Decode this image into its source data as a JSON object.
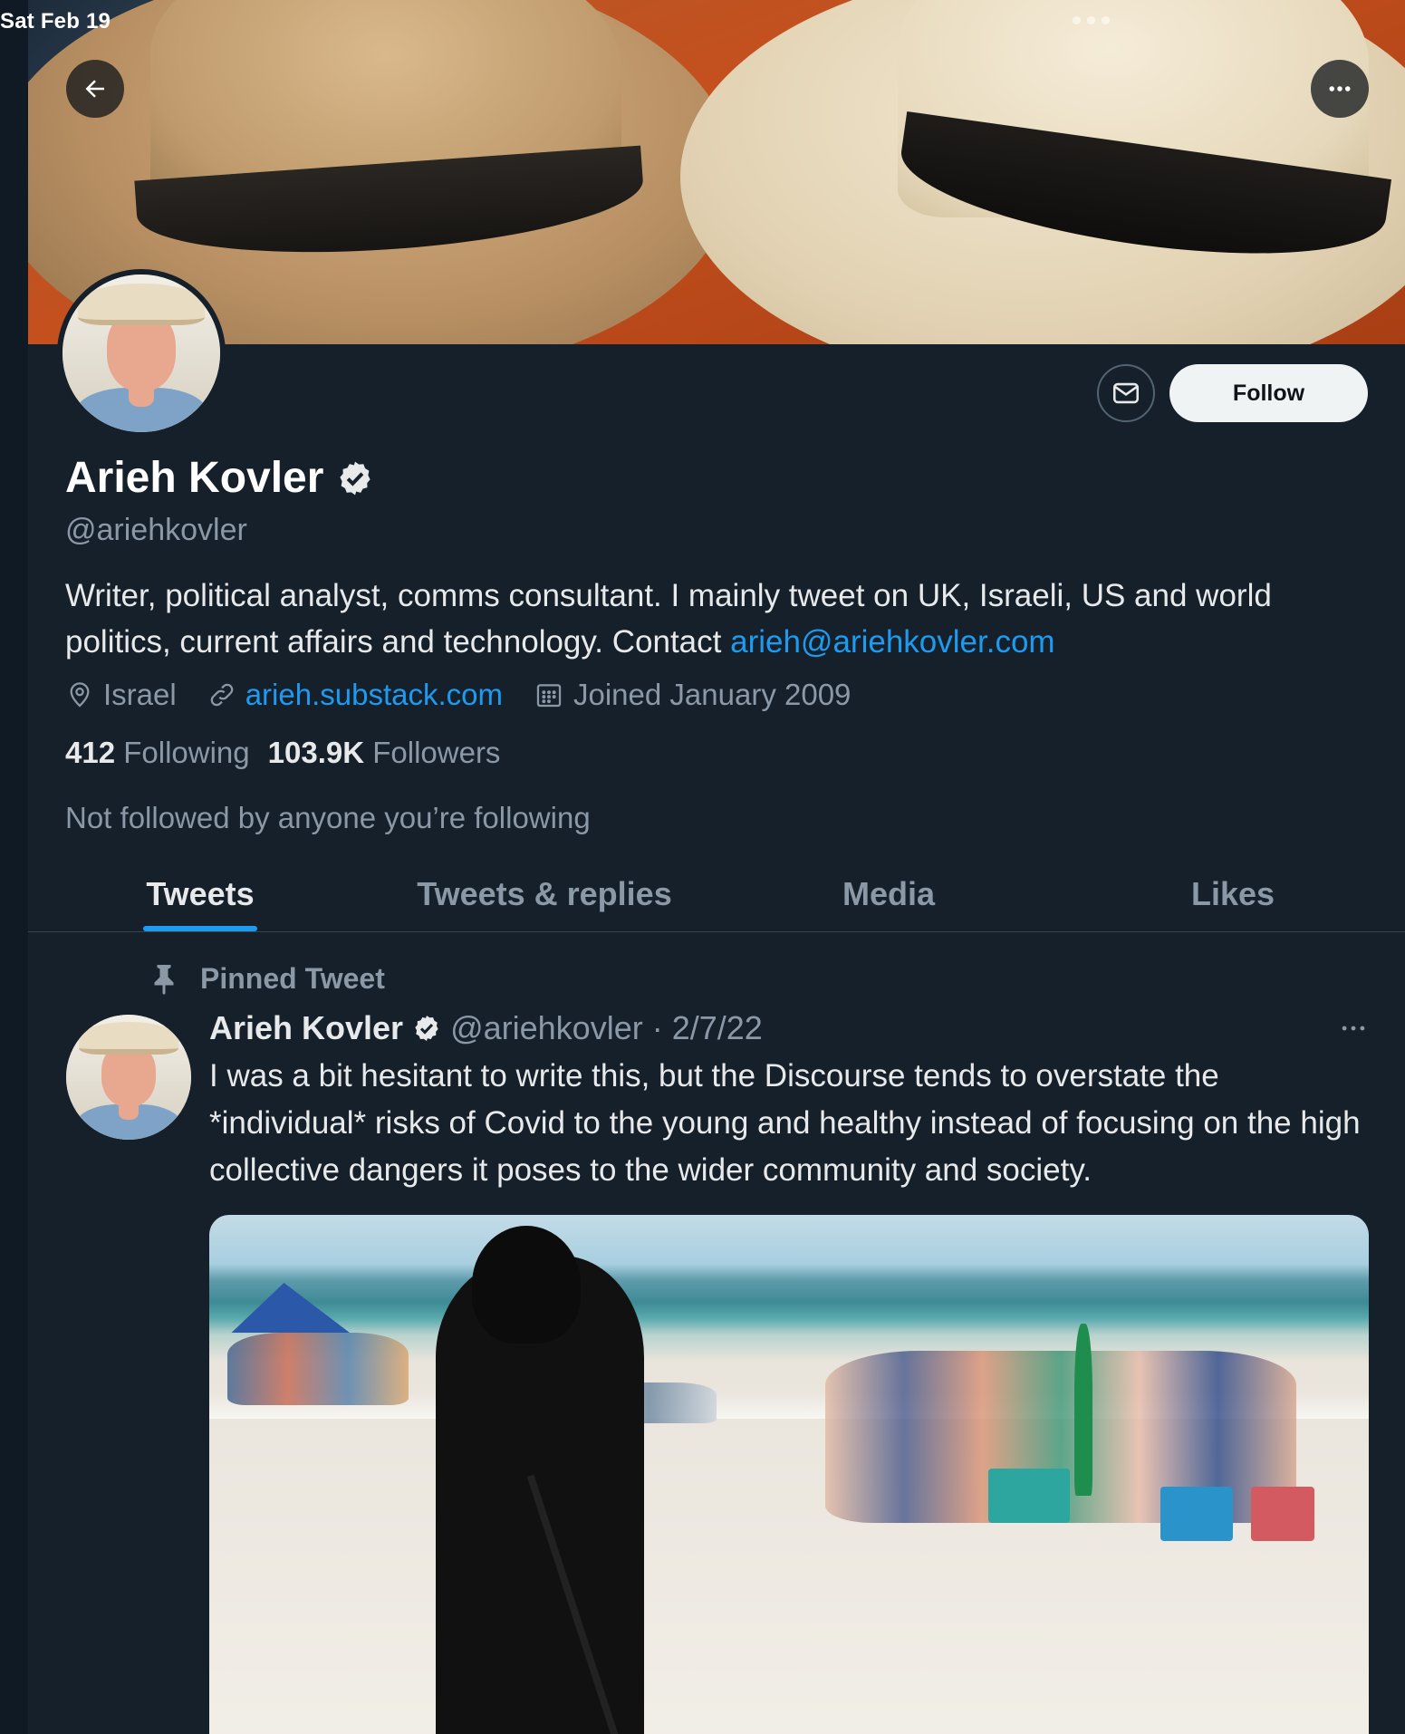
{
  "status_bar": {
    "time": "Sat Feb 19"
  },
  "profile": {
    "name": "Arieh Kovler",
    "handle": "@ariehkovler",
    "bio_text": "Writer, political analyst, comms consultant. I mainly tweet on UK, Israeli, US and world politics, current affairs and technology. Contact ",
    "bio_link": "arieh@ariehkovler.com",
    "location": "Israel",
    "website": "arieh.substack.com",
    "joined": "Joined January 2009",
    "following_count": "412",
    "following_label": "Following",
    "followers_count": "103.9K",
    "followers_label": "Followers",
    "not_followed": "Not followed by anyone you’re following",
    "follow_button": "Follow"
  },
  "tabs": [
    {
      "label": "Tweets",
      "active": true
    },
    {
      "label": "Tweets & replies",
      "active": false
    },
    {
      "label": "Media",
      "active": false
    },
    {
      "label": "Likes",
      "active": false
    }
  ],
  "pinned_tweet": {
    "pinned_label": "Pinned Tweet",
    "author": "Arieh Kovler",
    "handle_date": "@ariehkovler · 2/7/22",
    "text": "I was a bit hesitant to write this, but the Discourse tends to overstate the *individual* risks of Covid to the young and healthy instead of focusing on the high collective dangers it poses to the wider community and society."
  },
  "icons": {
    "back": "arrow-left-icon",
    "more": "more-horizontal-icon",
    "message": "envelope-icon",
    "verified": "verified-badge-icon",
    "location": "location-pin-icon",
    "link": "link-icon",
    "calendar": "calendar-icon",
    "pin": "pin-icon"
  },
  "colors": {
    "background": "#15202b",
    "accent": "#1d9bf0",
    "secondary_text": "#8b98a5",
    "primary_text": "#e7e9ea"
  }
}
